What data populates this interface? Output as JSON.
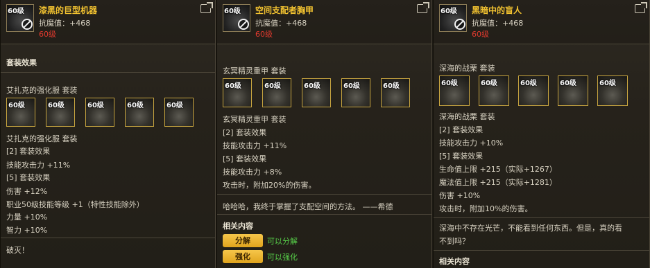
{
  "panels": [
    {
      "thumb_level": "60级",
      "title": "漆黑的巨型机器",
      "stat": "抗魔值：+468",
      "req_level": "60级",
      "set_effect_header": "套装效果",
      "set_name": "艾扎克的强化服 套装",
      "slots": [
        "60级",
        "60级",
        "60级",
        "60级",
        "60级"
      ],
      "set_name_2": "艾扎克的强化服 套装",
      "lines": [
        "[2] 套装效果",
        "技能攻击力 +11%",
        "[5] 套装效果",
        "伤害 +12%",
        "职业50级技能等级 +1（特性技能除外）",
        "力量 +10%",
        "智力 +10%"
      ],
      "flavor": "破灭！"
    },
    {
      "thumb_level": "60级",
      "title": "空间支配者胸甲",
      "stat": "抗魔值：+468",
      "req_level": "60级",
      "set_name": "玄冥精灵重甲 套装",
      "slots": [
        "60级",
        "60级",
        "60级",
        "60级",
        "60级"
      ],
      "set_name_2": "玄冥精灵重甲 套装",
      "lines": [
        "[2] 套装效果",
        "技能攻击力 +11%",
        "[5] 套装效果",
        "技能攻击力 +8%",
        "攻击时，附加20%的伤害。"
      ],
      "flavor": "哈哈哈，我终于掌握了支配空间的方法。 ——希德",
      "related_header": "相关内容",
      "actions": [
        {
          "label": "分解",
          "note": "可以分解"
        },
        {
          "label": "强化",
          "note": "可以强化"
        }
      ]
    },
    {
      "thumb_level": "60级",
      "title": "黑暗中的盲人",
      "stat": "抗魔值：+468",
      "req_level": "60级",
      "set_name": "深海的战栗 套装",
      "slots": [
        "60级",
        "60级",
        "60级",
        "60级",
        "60级"
      ],
      "set_name_2": "深海的战栗 套装",
      "lines": [
        "[2] 套装效果",
        "技能攻击力 +10%",
        "[5] 套装效果",
        "生命值上限 +215（实际+1267）",
        "魔法值上限 +215（实际+1281）",
        "伤害 +10%",
        "攻击时，附加10%的伤害。"
      ],
      "flavor_1": "深海中不存在光芒，不能看到任何东西。但是，真的看",
      "flavor_2": "不到吗？",
      "related_header": "相关内容"
    }
  ],
  "colors": {
    "title": "#f2c230",
    "required_level": "#e23a2e",
    "action_note": "#58d24a",
    "slot_border": "#c9a640"
  },
  "icons": {
    "header_right": "external-link-icon",
    "thumb_overlay": "prohibited-icon"
  }
}
